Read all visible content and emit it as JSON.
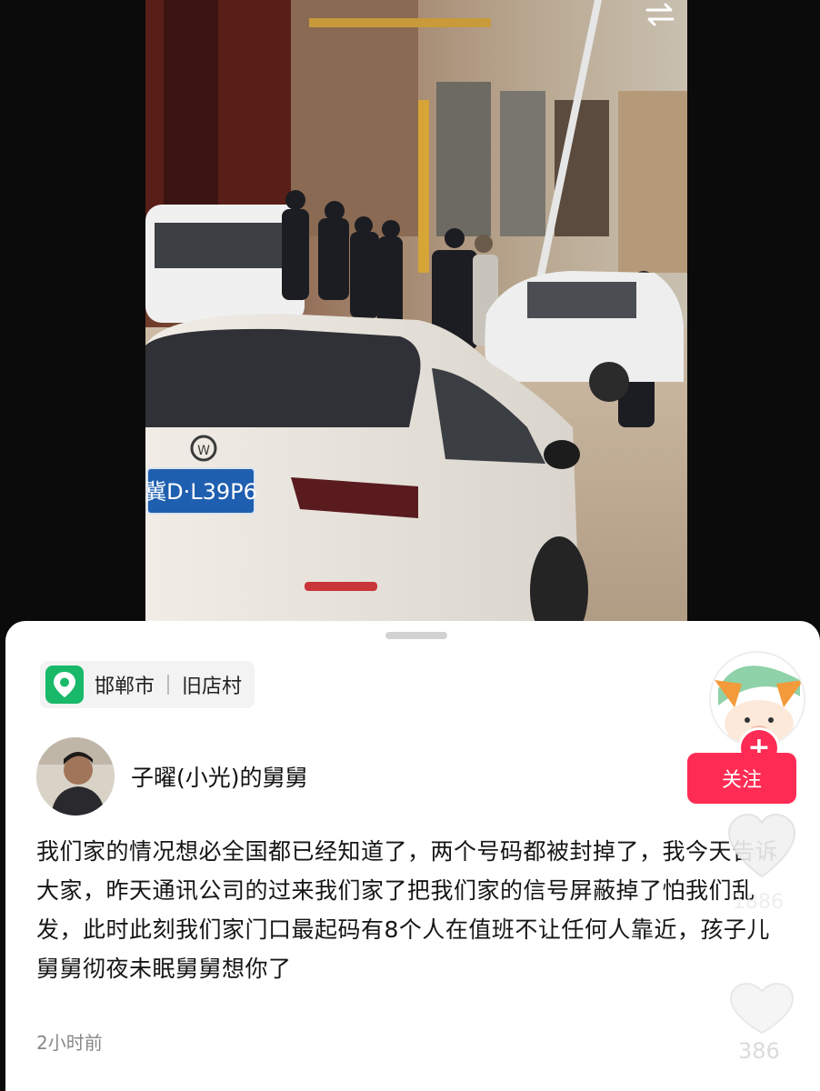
{
  "media": {
    "plate_text": "冀D·L39P6"
  },
  "icons": {
    "switch": "swap-arrows-icon",
    "location": "location-pin-icon",
    "like": "heart-icon",
    "follow_plus": "plus-icon"
  },
  "location": {
    "city": "邯郸市",
    "village": "旧店村"
  },
  "author": {
    "name": "子曜(小光)的舅舅"
  },
  "post": {
    "text": "我们家的情况想必全国都已经知道了，两个号码都被封掉了，我今天告诉大家，昨天通讯公司的过来我们家了把我们家的信号屏蔽掉了怕我们乱发，此时此刻我们家门口最起码有8个人在值班不让任何人靠近，孩子儿舅舅彻夜未眠舅舅想你了",
    "time": "2小时前"
  },
  "rail": {
    "follow_label": "关注",
    "plus": "+",
    "like_count": "1886",
    "comment_count": "386"
  },
  "colors": {
    "accent": "#fe2c55",
    "location_green": "#19b96a"
  }
}
